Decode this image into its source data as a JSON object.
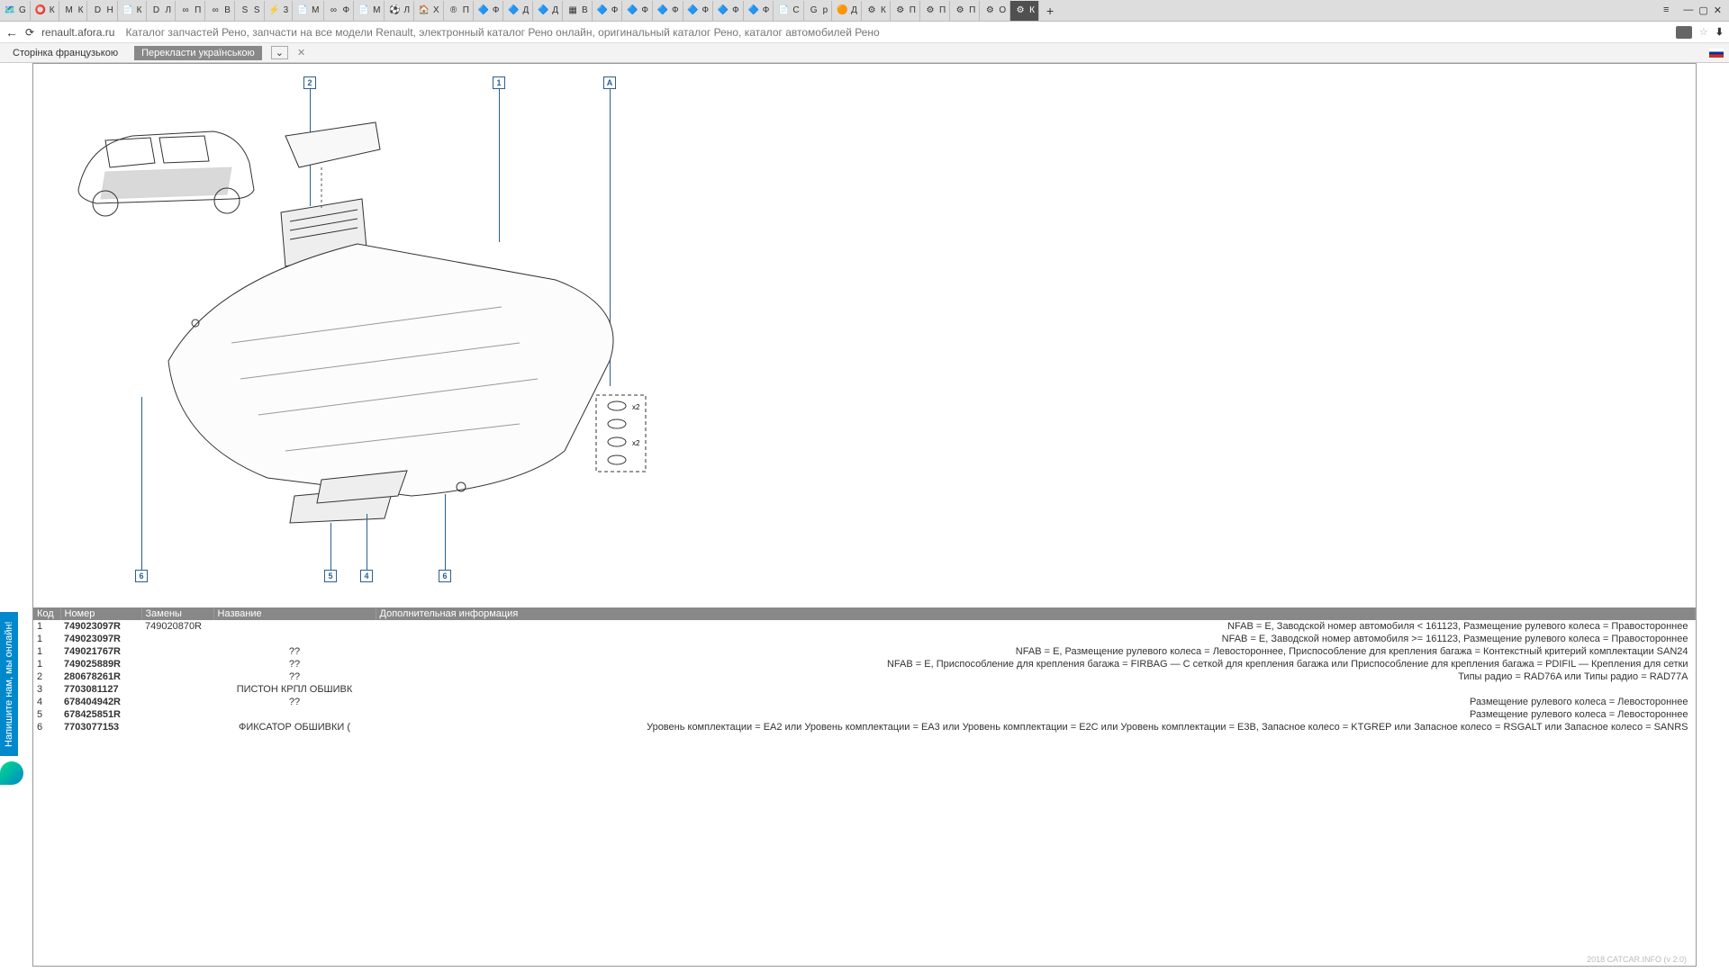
{
  "browser": {
    "tabs": [
      {
        "icon": "🗺️",
        "label": "G"
      },
      {
        "icon": "⭕",
        "label": "К"
      },
      {
        "icon": "M",
        "label": "К"
      },
      {
        "icon": "D",
        "label": "Н"
      },
      {
        "icon": "📄",
        "label": "К"
      },
      {
        "icon": "D",
        "label": "Л"
      },
      {
        "icon": "∞",
        "label": "П"
      },
      {
        "icon": "∞",
        "label": "В"
      },
      {
        "icon": "S",
        "label": "S"
      },
      {
        "icon": "⚡",
        "label": "3"
      },
      {
        "icon": "📄",
        "label": "М"
      },
      {
        "icon": "∞",
        "label": "Ф"
      },
      {
        "icon": "📄",
        "label": "М"
      },
      {
        "icon": "⚽",
        "label": "Л"
      },
      {
        "icon": "🏠",
        "label": "Х"
      },
      {
        "icon": "®",
        "label": "П"
      },
      {
        "icon": "🔷",
        "label": "Ф"
      },
      {
        "icon": "🔷",
        "label": "Д"
      },
      {
        "icon": "🔷",
        "label": "Д"
      },
      {
        "icon": "▦",
        "label": "В"
      },
      {
        "icon": "🔷",
        "label": "Ф"
      },
      {
        "icon": "🔷",
        "label": "Ф"
      },
      {
        "icon": "🔷",
        "label": "Ф"
      },
      {
        "icon": "🔷",
        "label": "Ф"
      },
      {
        "icon": "🔷",
        "label": "Ф"
      },
      {
        "icon": "🔷",
        "label": "Ф"
      },
      {
        "icon": "📄",
        "label": "С"
      },
      {
        "icon": "G",
        "label": "р"
      },
      {
        "icon": "🟠",
        "label": "Д"
      },
      {
        "icon": "⚙",
        "label": "К"
      },
      {
        "icon": "⚙",
        "label": "П"
      },
      {
        "icon": "⚙",
        "label": "П"
      },
      {
        "icon": "⚙",
        "label": "П"
      },
      {
        "icon": "⚙",
        "label": "О"
      },
      {
        "icon": "⚙",
        "label": "К",
        "active": true
      }
    ],
    "url": "renault.afora.ru",
    "page_title": "Каталог запчастей Рено, запчасти на все модели Renault, электронный каталог Рено онлайн, оригинальный каталог Рено, каталог автомобилей Рено"
  },
  "translate": {
    "source": "Сторінка французькою",
    "target": "Перекласти українською"
  },
  "diagram": {
    "top_callouts": [
      "2",
      "1",
      "A"
    ],
    "bottom_callouts": [
      "6",
      "5",
      "4",
      "6"
    ]
  },
  "table": {
    "headers": [
      "Код",
      "Номер",
      "Замены",
      "Название",
      "Дополнительная информация"
    ],
    "rows": [
      {
        "code": "1",
        "num": "749023097R",
        "rep": "749020870R",
        "name": "",
        "info": "NFAB = E, Заводской номер автомобиля < 161123, Размещение рулевого колеса = Правостороннее"
      },
      {
        "code": "1",
        "num": "749023097R",
        "rep": "",
        "name": "",
        "info": "NFAB = E, Заводской номер автомобиля >= 161123, Размещение рулевого колеса = Правостороннее"
      },
      {
        "code": "1",
        "num": "749021767R",
        "rep": "",
        "name": "??",
        "info": "NFAB = E, Размещение рулевого колеса = Левостороннее, Приспособление для крепления багажа = Контекстный критерий комплектации SAN24"
      },
      {
        "code": "1",
        "num": "749025889R",
        "rep": "",
        "name": "??",
        "info": "NFAB = E, Приспособление для крепления багажа = FIRBAG — С сеткой для крепления багажа или Приспособление для крепления багажа = PDIFIL — Крепления для сетки"
      },
      {
        "code": "2",
        "num": "280678261R",
        "rep": "",
        "name": "??",
        "info": "Типы радио = RAD76A или Типы радио = RAD77A"
      },
      {
        "code": "3",
        "num": "7703081127",
        "rep": "",
        "name": "ПИСТОН КРПЛ ОБШИВК",
        "info": ""
      },
      {
        "code": "4",
        "num": "678404942R",
        "rep": "",
        "name": "??",
        "info": "Размещение рулевого колеса = Левостороннее"
      },
      {
        "code": "5",
        "num": "678425851R",
        "rep": "",
        "name": "",
        "info": "Размещение рулевого колеса = Левостороннее"
      },
      {
        "code": "6",
        "num": "7703077153",
        "rep": "",
        "name": "ФИКСАТОР ОБШИВКИ (",
        "info": "Уровень комплектации = EA2 или Уровень комплектации = EA3 или Уровень комплектации = E2C или Уровень комплектации = E3B, Запасное колесо = KTGREP или Запасное колесо = RSGALT или Запасное колесо = SANRS"
      }
    ]
  },
  "chat": {
    "label": "Напишите нам, мы онлайн!"
  },
  "footer": "2018 CATCAR.INFO (v 2.0)"
}
